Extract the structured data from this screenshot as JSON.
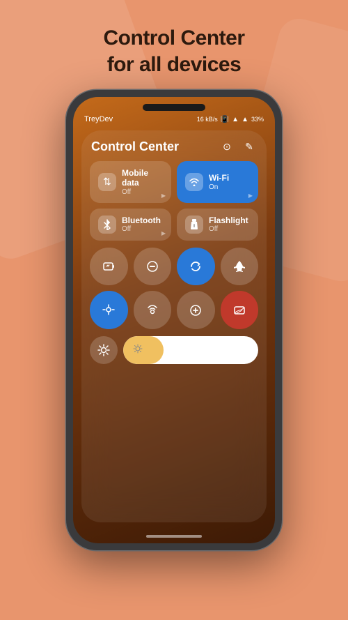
{
  "headline": {
    "line1": "Control Center",
    "line2": "for all devices"
  },
  "status": {
    "carrier": "TreyDev",
    "speed": "16 kB/s",
    "battery": "33%"
  },
  "control_center": {
    "title": "Control Center",
    "toggles": [
      {
        "id": "mobile-data",
        "label": "Mobile data",
        "state": "Off",
        "active": false,
        "icon": "⇅"
      },
      {
        "id": "wifi",
        "label": "Wi-Fi",
        "state": "On",
        "active": true,
        "icon": "▲"
      },
      {
        "id": "bluetooth",
        "label": "Bluetooth",
        "state": "Off",
        "active": false,
        "icon": "✦"
      },
      {
        "id": "flashlight",
        "label": "Flashlight",
        "state": "Off",
        "active": false,
        "icon": "🔦"
      }
    ],
    "round_buttons": [
      {
        "id": "battery",
        "icon": "⊟",
        "color": "gray"
      },
      {
        "id": "focus",
        "icon": "⊖",
        "color": "gray"
      },
      {
        "id": "sync",
        "icon": "↺",
        "color": "blue"
      },
      {
        "id": "airplane",
        "icon": "✈",
        "color": "gray"
      },
      {
        "id": "location",
        "icon": "◉",
        "color": "blue"
      },
      {
        "id": "hotspot",
        "icon": "⊙",
        "color": "gray"
      },
      {
        "id": "plus",
        "icon": "⊕",
        "color": "gray"
      },
      {
        "id": "cast",
        "icon": "▣",
        "color": "red"
      }
    ],
    "brightness": {
      "icon": "☀",
      "level": 30
    }
  }
}
